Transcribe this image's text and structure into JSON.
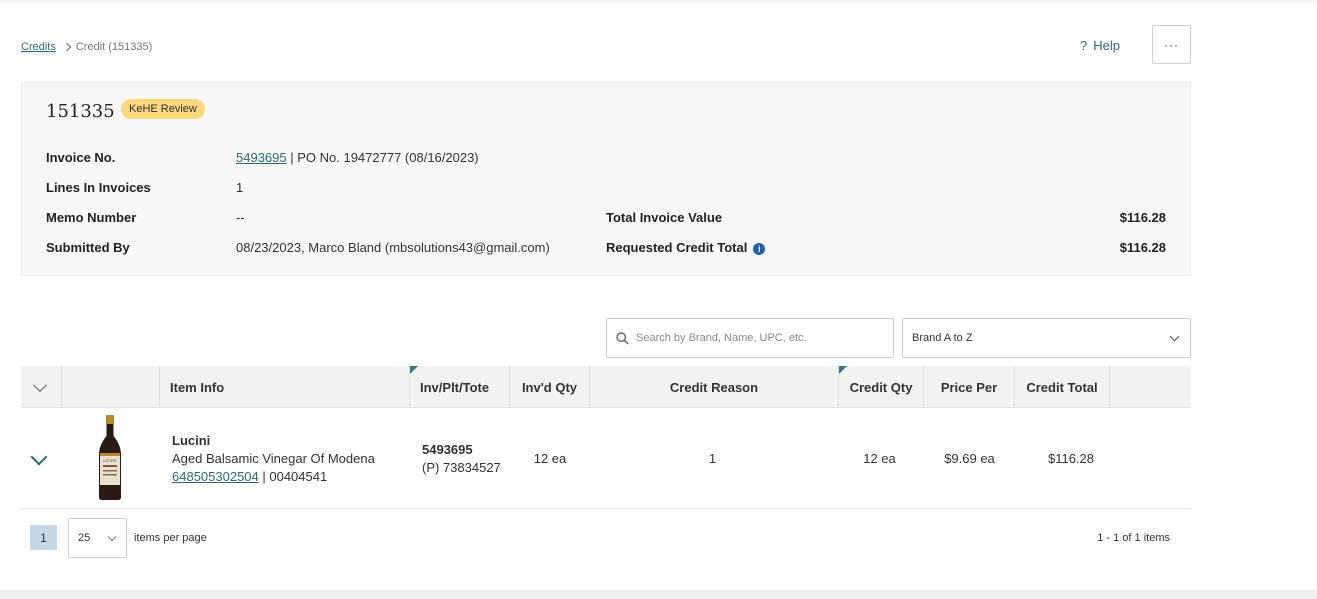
{
  "breadcrumb": {
    "root": "Credits",
    "current": "Credit (151335)"
  },
  "header": {
    "help_label": "Help",
    "help_icon": "?",
    "more_label": "···"
  },
  "summary": {
    "credit_id": "151335",
    "status_badge": "KeHE Review",
    "invoice_label": "Invoice No.",
    "invoice_number": "5493695",
    "invoice_po": " | PO No. 19472777 (08/16/2023)",
    "lines_label": "Lines In Invoices",
    "lines_value": "1",
    "memo_label": "Memo Number",
    "memo_value": "--",
    "submitted_label": "Submitted By",
    "submitted_value": "08/23/2023, Marco Bland (mbsolutions43@gmail.com)",
    "total_invoice_label": "Total Invoice Value",
    "total_invoice_value": "$116.28",
    "requested_label": "Requested Credit Total",
    "requested_value": "$116.28",
    "info_icon": "i"
  },
  "filters": {
    "search_placeholder": "Search by Brand, Name, UPC, etc.",
    "sort_value": "Brand A to Z"
  },
  "table": {
    "columns": [
      "Item Info",
      "Inv/Plt/Tote",
      "Inv'd Qty",
      "Credit Reason",
      "Credit Qty",
      "Price Per",
      "Credit Total"
    ],
    "rows": [
      {
        "brand": "Lucini",
        "name": "Aged Balsamic Vinegar Of Modena",
        "upc": "648505302504",
        "item_code": " | 00404541",
        "invoice": "5493695",
        "pallet": "(P) 73834527",
        "invd_qty": "12 ea",
        "credit_reason": "1",
        "credit_qty": "12 ea",
        "price_per": "$9.69 ea",
        "credit_total": "$116.28",
        "bottle_label": "LUCINI"
      }
    ]
  },
  "pager": {
    "current_page": "1",
    "per_page": "25",
    "per_page_label": "items per page",
    "count": "1 - 1 of 1 items"
  },
  "colors": {
    "accent": "#2e6a73",
    "badge": "#fbd77e",
    "info": "#1f5ea8",
    "page_active": "#c6d7e5"
  }
}
